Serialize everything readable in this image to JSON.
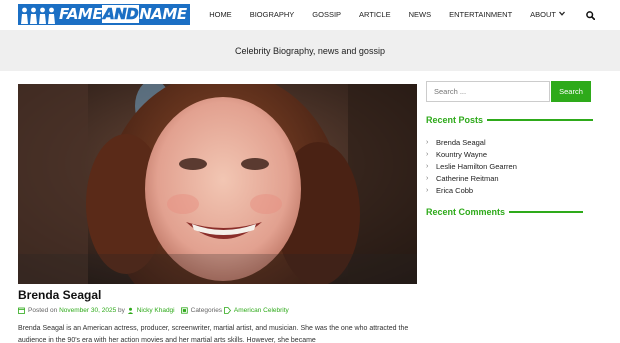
{
  "header": {
    "logo_text": "FAMEANDNAME",
    "logo_text_a": "FAME",
    "logo_text_b": "AND",
    "logo_text_c": "NAME",
    "nav": [
      "HOME",
      "BIOGRAPHY",
      "GOSSIP",
      "ARTICLE",
      "NEWS",
      "ENTERTAINMENT",
      "ABOUT"
    ],
    "search_icon": "search-icon",
    "about_icon": "chevron-down-icon"
  },
  "banner": {
    "tagline": "Celebrity Biography, news and gossip"
  },
  "post": {
    "title": "Brenda Seagal",
    "posted_on_label": "Posted on",
    "date": "November 30, 2025",
    "by_label": "by",
    "author": "Nicky Khadgi",
    "categories_label": "Categories",
    "category": "American Celebrity",
    "excerpt": "Brenda Seagal is an American actress, producer, screenwriter, martial artist, and musician. She was the one who attracted the audience in the 90's era with her action movies and her martial arts skills. However, she became"
  },
  "sidebar": {
    "search_placeholder": "Search ...",
    "search_button": "Search",
    "recent_posts_title": "Recent Posts",
    "recent_posts": [
      "Brenda Seagal",
      "Kountry Wayne",
      "Leslie Hamilton Gearren",
      "Catherine Reitman",
      "Erica Cobb"
    ],
    "recent_comments_title": "Recent Comments"
  },
  "colors": {
    "accent": "#2eaa1a",
    "logo_blue": "#1b6fc4",
    "banner_bg": "#efefef"
  }
}
